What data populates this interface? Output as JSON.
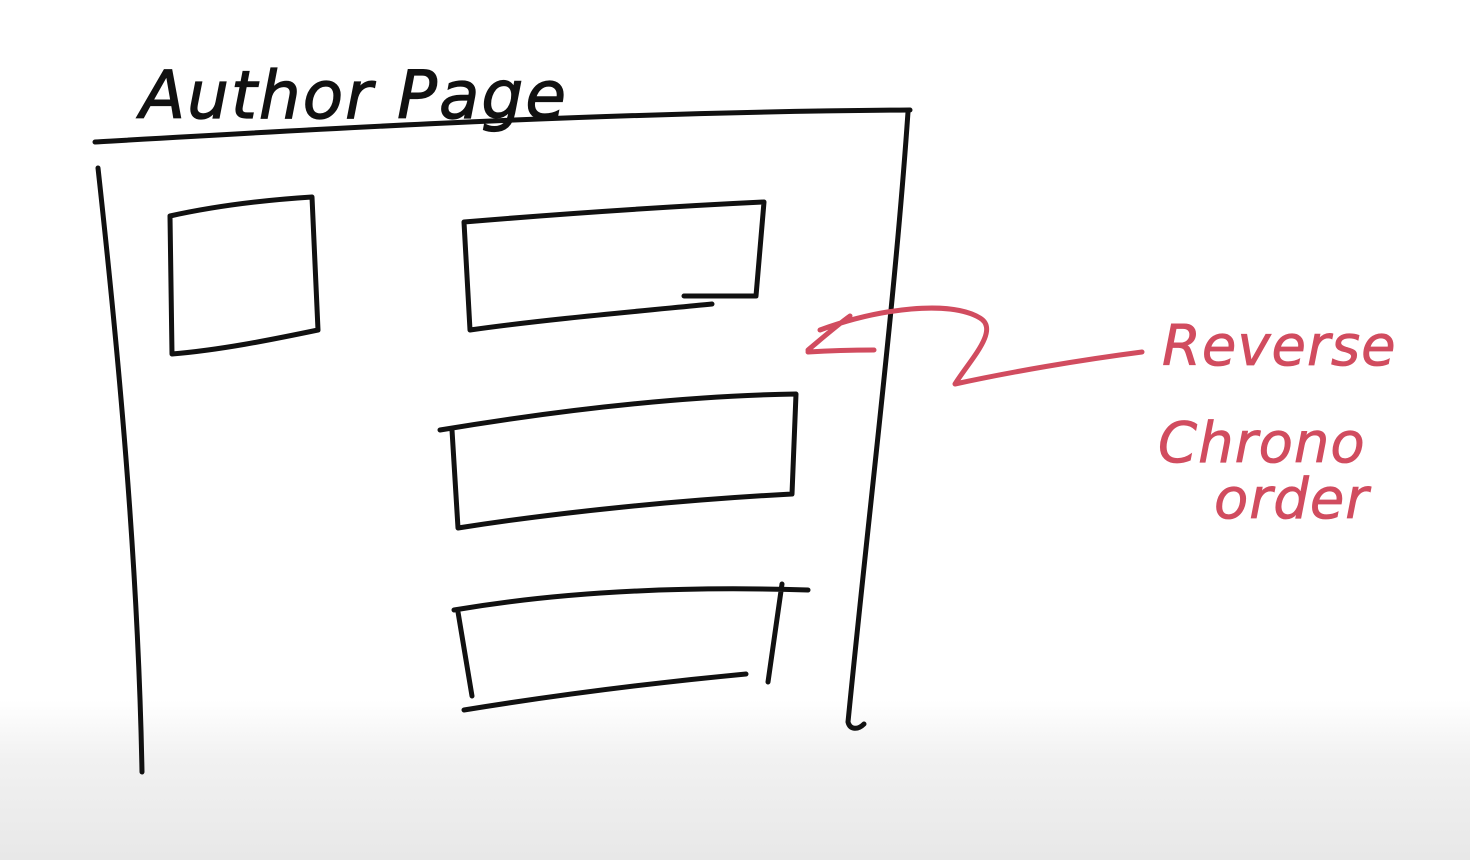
{
  "title": "Author Page",
  "annotation": {
    "line1": "Reverse",
    "line2": "Chrono",
    "line3": "order"
  },
  "colors": {
    "ink": "#111111",
    "annotation": "#d14c5f",
    "background": "#ffffff"
  }
}
